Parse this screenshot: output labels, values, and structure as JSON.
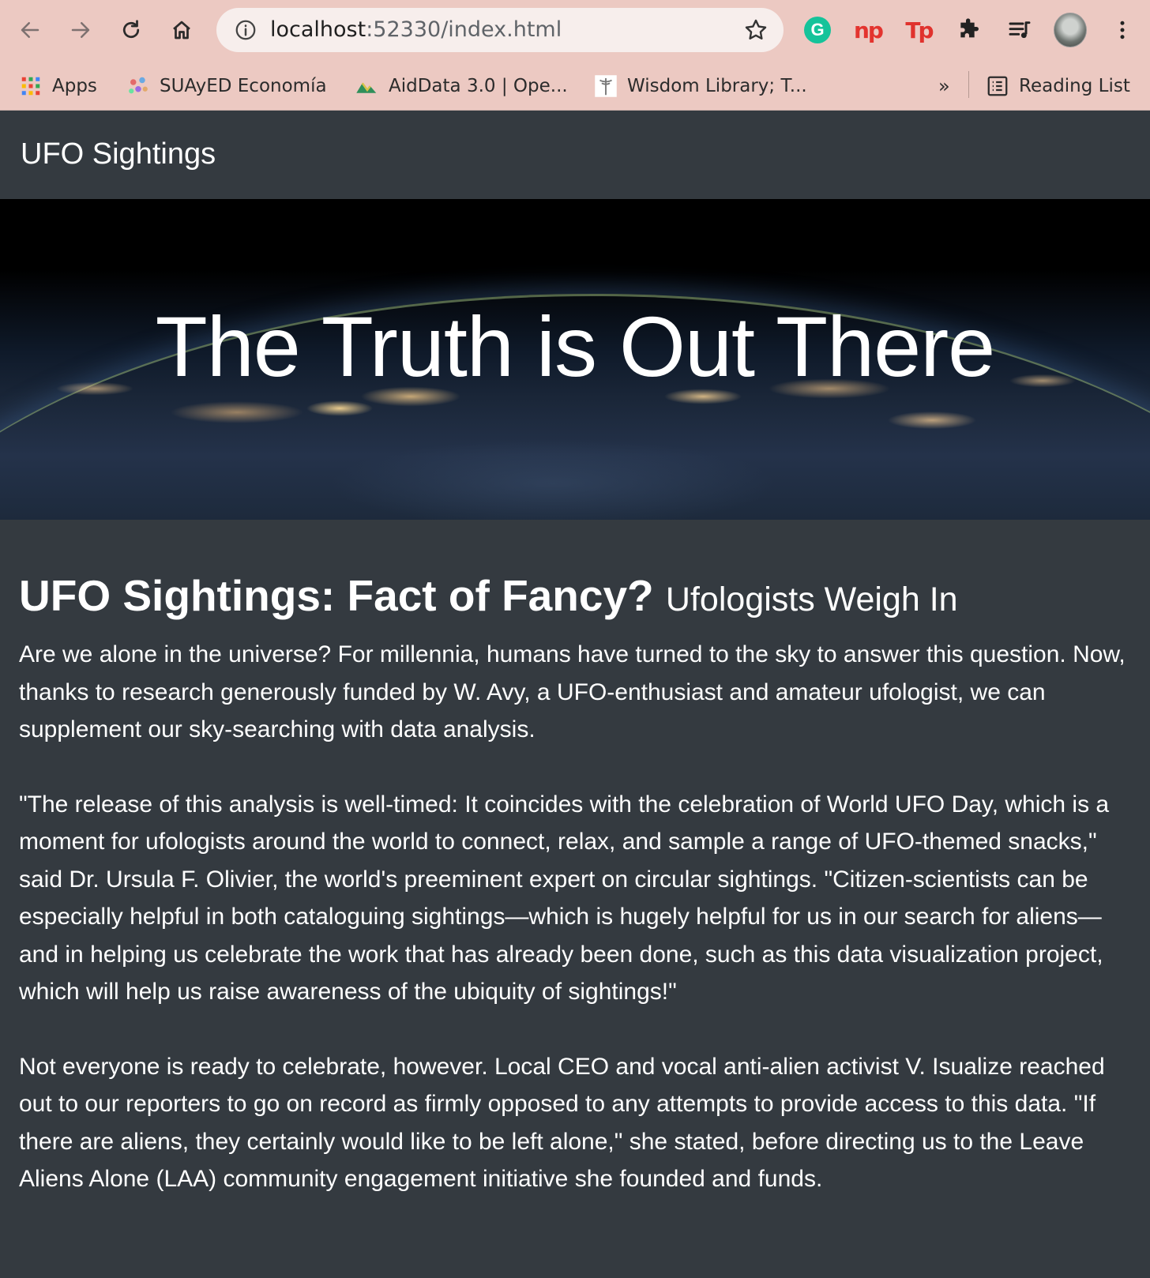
{
  "browser": {
    "url_host": "localhost",
    "url_rest": ":52330/index.html",
    "bookmarks": [
      {
        "label": "Apps",
        "icon": "apps-grid-icon"
      },
      {
        "label": "SUAyED Economía",
        "icon": "suayed-icon"
      },
      {
        "label": "AidData 3.0 | Ope...",
        "icon": "aiddata-icon"
      },
      {
        "label": "Wisdom Library; T...",
        "icon": "wisdom-library-icon"
      }
    ],
    "overflow_label": "»",
    "reading_list_label": "Reading List",
    "extensions": [
      "grammarly-icon",
      "np-icon",
      "tp-icon",
      "extensions-puzzle-icon",
      "media-playlist-icon",
      "profile-avatar-icon",
      "menu-kebab-icon"
    ],
    "extension_text": {
      "g": "G",
      "np": "np",
      "tp": "Tp"
    }
  },
  "navbar": {
    "brand": "UFO Sightings"
  },
  "hero": {
    "title": "The Truth is Out There"
  },
  "article": {
    "headline": "UFO Sightings: Fact of Fancy?",
    "subheadline": "Ufologists Weigh In",
    "paragraphs": [
      "Are we alone in the universe? For millennia, humans have turned to the sky to answer this question. Now, thanks to research generously funded by W. Avy, a UFO-enthusiast and amateur ufologist, we can supplement our sky-searching with data analysis.",
      "\"The release of this analysis is well-timed: It coincides with the celebration of World UFO Day, which is a moment for ufologists around the world to connect, relax, and sample a range of UFO-themed snacks,\" said Dr. Ursula F. Olivier, the world's preeminent expert on circular sightings. \"Citizen-scientists can be especially helpful in both cataloguing sightings—which is hugely helpful for us in our search for aliens—and in helping us celebrate the work that has already been done, such as this data visualization project, which will help us raise awareness of the ubiquity of sightings!\"",
      "Not everyone is ready to celebrate, however. Local CEO and vocal anti-alien activist V. Isualize reached out to our reporters to go on record as firmly opposed to any attempts to provide access to this data. \"If there are aliens, they certainly would like to be left alone,\" she stated, before directing us to the Leave Aliens Alone (LAA) community engagement initiative she founded and funds."
    ]
  },
  "colors": {
    "chrome": "#ecc9c2",
    "page_bg": "#343a40",
    "text": "#ffffff"
  }
}
